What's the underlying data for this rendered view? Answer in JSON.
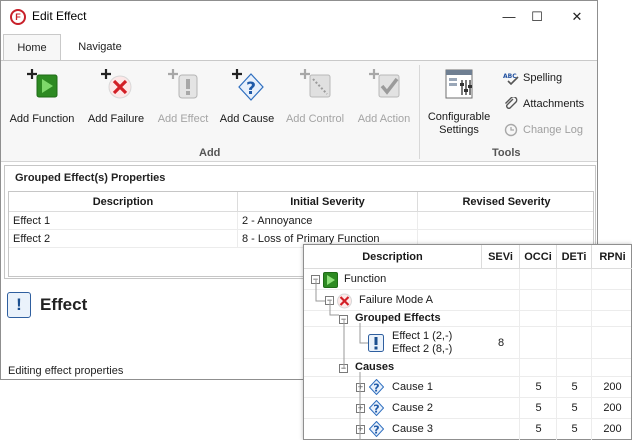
{
  "window": {
    "title": "Edit Effect",
    "app_icon_letter": "F"
  },
  "titlebar_buttons": {
    "minimize": "—",
    "maximize": "☐",
    "close": "✕"
  },
  "ribbon_tabs": [
    {
      "label": "Home"
    },
    {
      "label": "Navigate"
    }
  ],
  "ribbon": {
    "add_group": {
      "label": "Add",
      "buttons": [
        {
          "label": "Add Function",
          "icon": "add-function-icon",
          "enabled": true
        },
        {
          "label": "Add Failure",
          "icon": "add-failure-icon",
          "enabled": true
        },
        {
          "label": "Add Effect",
          "icon": "add-effect-icon",
          "enabled": false
        },
        {
          "label": "Add Cause",
          "icon": "add-cause-icon",
          "enabled": true
        },
        {
          "label": "Add Control",
          "icon": "add-control-icon",
          "enabled": false
        },
        {
          "label": "Add Action",
          "icon": "add-action-icon",
          "enabled": false
        }
      ]
    },
    "tools_group": {
      "label": "Tools",
      "configurable_settings": {
        "line1": "Configurable",
        "line2": "Settings"
      },
      "spelling": "Spelling",
      "spelling_icon_text": "ABC",
      "attachments": "Attachments",
      "change_log": "Change Log"
    }
  },
  "grouped_effects": {
    "title": "Grouped Effect(s) Properties",
    "columns": [
      "Description",
      "Initial Severity",
      "Revised Severity"
    ],
    "rows": [
      {
        "description": "Effect 1",
        "initial": "2 - Annoyance",
        "revised": ""
      },
      {
        "description": "Effect 2",
        "initial": "8 - Loss of Primary Function",
        "revised": ""
      }
    ]
  },
  "effect_heading": {
    "icon_glyph": "!",
    "text": "Effect"
  },
  "status": "Editing effect properties",
  "tree": {
    "columns": [
      "Description",
      "SEVi",
      "OCCi",
      "DETi",
      "RPNi"
    ],
    "function": {
      "label": "Function",
      "expander": "−"
    },
    "failure_mode": {
      "label": "Failure Mode A",
      "expander": "−"
    },
    "grouped_effects": {
      "label": "Grouped Effects",
      "expander": "−",
      "effect1": "Effect 1 (2,-)",
      "effect2": "Effect 2 (8,-)",
      "sev": "8"
    },
    "causes": {
      "label": "Causes",
      "expander": "−",
      "items": [
        {
          "label": "Cause 1",
          "expander": "+",
          "occ": "5",
          "det": "5",
          "rpn": "200"
        },
        {
          "label": "Cause 2",
          "expander": "+",
          "occ": "5",
          "det": "5",
          "rpn": "200"
        },
        {
          "label": "Cause 3",
          "expander": "+",
          "occ": "5",
          "det": "5",
          "rpn": "200"
        }
      ]
    }
  },
  "colors": {
    "accent_red": "#c8202a",
    "function_green": "#3a9b2a",
    "question_blue": "#2f6fbf",
    "disabled_gray": "#a4a4a4"
  }
}
